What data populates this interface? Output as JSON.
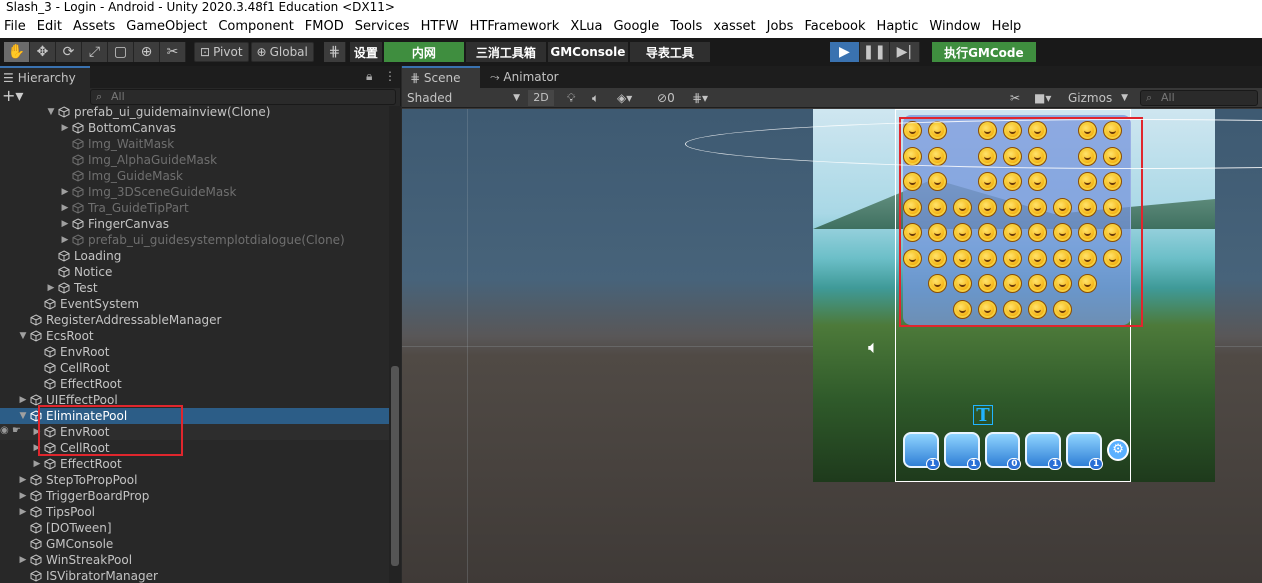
{
  "window": {
    "title": "Slash_3 - Login - Android - Unity 2020.3.48f1 Education <DX11>"
  },
  "menu": [
    "File",
    "Edit",
    "Assets",
    "GameObject",
    "Component",
    "FMOD",
    "Services",
    "HTFW",
    "HTFramework",
    "XLua",
    "Google",
    "Tools",
    "xasset",
    "Jobs",
    "Facebook",
    "Haptic",
    "Window",
    "Help"
  ],
  "toolbar": {
    "pivot": "Pivot",
    "global": "Global",
    "settings": "设置",
    "intranet": "内网",
    "match3_tools": "三消工具箱",
    "gmconsole": "GMConsole",
    "export_tools": "导表工具",
    "exec_gm": "执行GMCode",
    "tool_icons": [
      "hand-icon",
      "move-icon",
      "rotate-icon",
      "scale-icon",
      "rect-icon",
      "transform-icon",
      "custom-tool-icon"
    ]
  },
  "hierarchy": {
    "tab": "Hierarchy",
    "search_placeholder": "All",
    "rows": [
      {
        "label": "prefab_ui_guidemainview(Clone)",
        "depth": 4,
        "arrow": "down",
        "dim": false
      },
      {
        "label": "BottomCanvas",
        "depth": 5,
        "arrow": "right",
        "dim": false
      },
      {
        "label": "Img_WaitMask",
        "depth": 5,
        "arrow": "",
        "dim": true
      },
      {
        "label": "Img_AlphaGuideMask",
        "depth": 5,
        "arrow": "",
        "dim": true
      },
      {
        "label": "Img_GuideMask",
        "depth": 5,
        "arrow": "",
        "dim": true
      },
      {
        "label": "Img_3DSceneGuideMask",
        "depth": 5,
        "arrow": "right",
        "dim": true
      },
      {
        "label": "Tra_GuideTipPart",
        "depth": 5,
        "arrow": "right",
        "dim": true
      },
      {
        "label": "FingerCanvas",
        "depth": 5,
        "arrow": "right",
        "dim": false
      },
      {
        "label": "prefab_ui_guidesystemplotdialogue(Clone)",
        "depth": 5,
        "arrow": "right",
        "dim": true
      },
      {
        "label": "Loading",
        "depth": 4,
        "arrow": "",
        "dim": false
      },
      {
        "label": "Notice",
        "depth": 4,
        "arrow": "",
        "dim": false
      },
      {
        "label": "Test",
        "depth": 4,
        "arrow": "right",
        "dim": false
      },
      {
        "label": "EventSystem",
        "depth": 3,
        "arrow": "",
        "dim": false
      },
      {
        "label": "RegisterAddressableManager",
        "depth": 2,
        "arrow": "",
        "dim": false
      },
      {
        "label": "EcsRoot",
        "depth": 2,
        "arrow": "down",
        "dim": false
      },
      {
        "label": "EnvRoot",
        "depth": 3,
        "arrow": "",
        "dim": false
      },
      {
        "label": "CellRoot",
        "depth": 3,
        "arrow": "",
        "dim": false
      },
      {
        "label": "EffectRoot",
        "depth": 3,
        "arrow": "",
        "dim": false
      },
      {
        "label": "UIEffectPool",
        "depth": 2,
        "arrow": "right",
        "dim": false
      },
      {
        "label": "EliminatePool",
        "depth": 2,
        "arrow": "down",
        "dim": false,
        "selected": true
      },
      {
        "label": "EnvRoot",
        "depth": 3,
        "arrow": "right",
        "dim": false,
        "alt": true
      },
      {
        "label": "CellRoot",
        "depth": 3,
        "arrow": "right",
        "dim": false
      },
      {
        "label": "EffectRoot",
        "depth": 3,
        "arrow": "right",
        "dim": false
      },
      {
        "label": "StepToPropPool",
        "depth": 2,
        "arrow": "right",
        "dim": false
      },
      {
        "label": "TriggerBoardProp",
        "depth": 2,
        "arrow": "right",
        "dim": false
      },
      {
        "label": "TipsPool",
        "depth": 2,
        "arrow": "right",
        "dim": false
      },
      {
        "label": "[DOTween]",
        "depth": 2,
        "arrow": "",
        "dim": false
      },
      {
        "label": "GMConsole",
        "depth": 2,
        "arrow": "",
        "dim": false
      },
      {
        "label": "WinStreakPool",
        "depth": 2,
        "arrow": "right",
        "dim": false
      },
      {
        "label": "ISVibratorManager",
        "depth": 2,
        "arrow": "",
        "dim": false
      }
    ]
  },
  "scene": {
    "tabs": [
      "Scene",
      "Animator"
    ],
    "shading": "Shaded",
    "mode2d": "2D",
    "hidden_count": "0",
    "gizmos": "Gizmos",
    "search_placeholder": "All",
    "board_rows": [
      [
        0,
        1,
        3,
        4,
        5,
        7,
        8
      ],
      [
        0,
        1,
        3,
        4,
        5,
        7,
        8
      ],
      [
        0,
        1,
        3,
        4,
        5,
        7,
        8
      ],
      [
        0,
        1,
        2,
        3,
        4,
        5,
        6,
        7,
        8
      ],
      [
        0,
        1,
        2,
        3,
        4,
        5,
        6,
        7,
        8
      ],
      [
        0,
        1,
        2,
        3,
        4,
        5,
        6,
        7,
        8
      ],
      [
        1,
        2,
        3,
        4,
        5,
        6,
        7
      ],
      [
        2,
        3,
        4,
        5,
        6
      ]
    ],
    "powerups": [
      {
        "count": "1"
      },
      {
        "count": "1"
      },
      {
        "count": "0"
      },
      {
        "count": "1"
      },
      {
        "count": "1"
      }
    ]
  }
}
